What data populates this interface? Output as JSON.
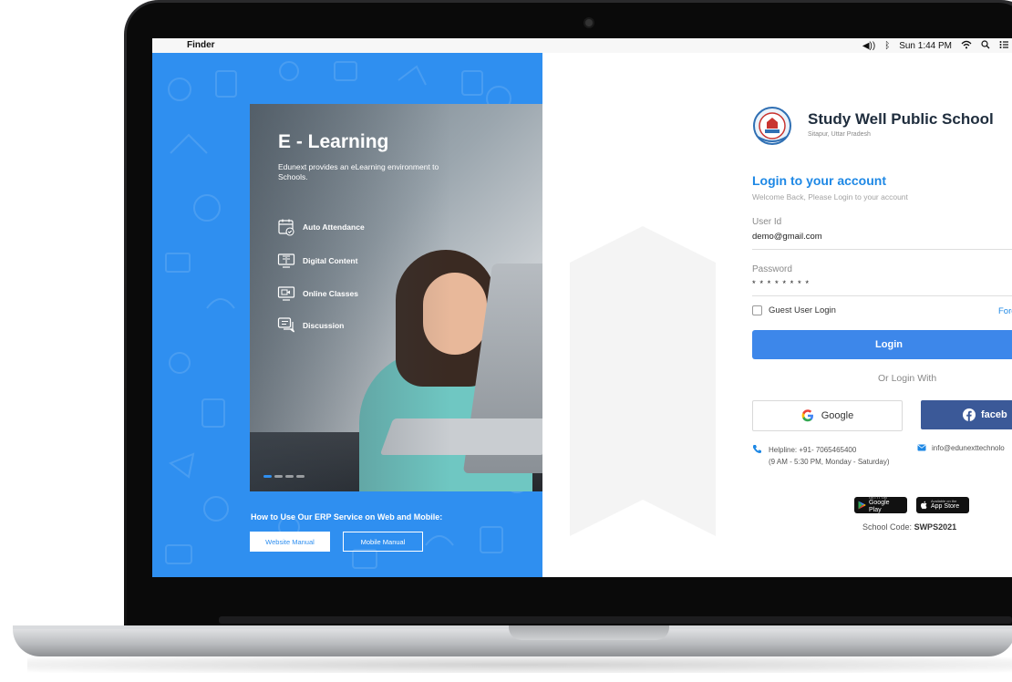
{
  "menubar": {
    "app_name": "Finder",
    "clock": "Sun 1:44 PM"
  },
  "hero": {
    "title": "E - Learning",
    "description": "Edunext provides an eLearning environment to Schools.",
    "features": [
      {
        "label": "Auto Attendance",
        "icon": "calendar-check-icon"
      },
      {
        "label": "Digital Content",
        "icon": "book-screen-icon"
      },
      {
        "label": "Online Classes",
        "icon": "video-screen-icon"
      },
      {
        "label": "Discussion",
        "icon": "chat-icon"
      }
    ]
  },
  "erp": {
    "text": "How to Use Our ERP Service on Web and Mobile:",
    "website_manual": "Website Manual",
    "mobile_manual": "Mobile Manual"
  },
  "school": {
    "name": "Study Well Public School",
    "location": "Sitapur, Uttar Pradesh"
  },
  "login": {
    "title": "Login to your account",
    "subtitle": "Welcome Back, Please Login to your account",
    "user_id_label": "User Id",
    "user_id_value": "demo@gmail.com",
    "password_label": "Password",
    "password_value": "* * * * * * * *",
    "guest_label": "Guest User Login",
    "forgot_label": "Forg",
    "login_button": "Login",
    "or_login_with": "Or Login With",
    "google_label": "Google",
    "facebook_label": "faceb"
  },
  "contact": {
    "helpline_prefix": "Helpline:",
    "helpline_number": "+91- 7065465400",
    "hours": "(9 AM - 5:30 PM, Monday - Saturday)",
    "email": "info@edunexttechnolo"
  },
  "stores": {
    "google_small": "GET IT ON",
    "google_big": "Google Play",
    "apple_small": "Available on the",
    "apple_big": "App Store"
  },
  "school_code": {
    "label": "School Code:",
    "value": "SWPS2021"
  },
  "colors": {
    "primary_blue": "#2f8ff0",
    "login_button": "#3d87ea",
    "facebook": "#3b5998",
    "title_blue": "#1e88e5"
  }
}
